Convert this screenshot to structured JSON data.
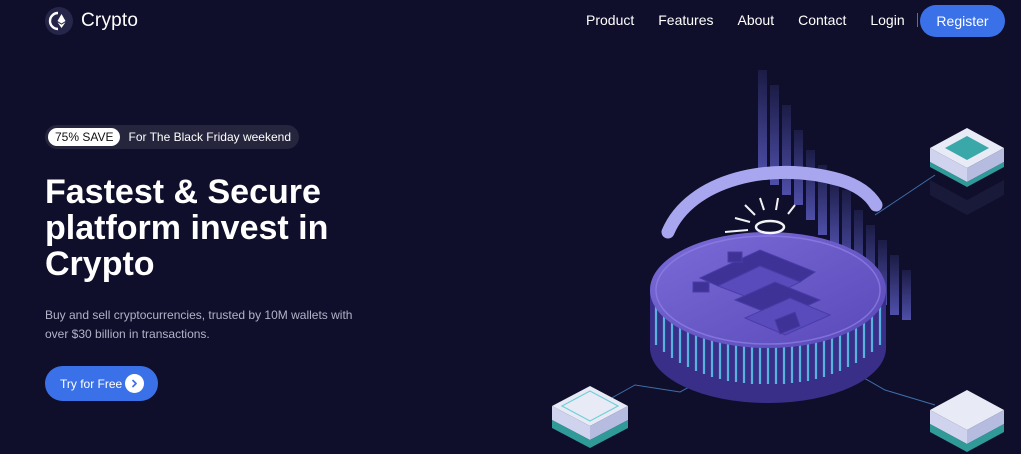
{
  "nav": {
    "brand": "Crypto",
    "links": [
      "Product",
      "Features",
      "About",
      "Contact",
      "Login"
    ],
    "register_label": "Register"
  },
  "hero": {
    "promo_badge": "75% SAVE",
    "promo_text": "For The Black Friday weekend",
    "title": "Fastest & Secure platform invest in Crypto",
    "subtitle": "Buy and sell cryptocurrencies, trusted by 10M wallets with over $30 billion in transactions.",
    "cta_label": "Try for Free"
  },
  "colors": {
    "background": "#0f0f2b",
    "accent": "#3a71e8",
    "coin": "#6c5bc8",
    "coin_rim": "#5aa8d8"
  },
  "icons": {
    "logo": "ethereum-logo-icon",
    "cta": "chevron-right-icon",
    "illustration": "bitcoin-coin-isometric-icon"
  }
}
